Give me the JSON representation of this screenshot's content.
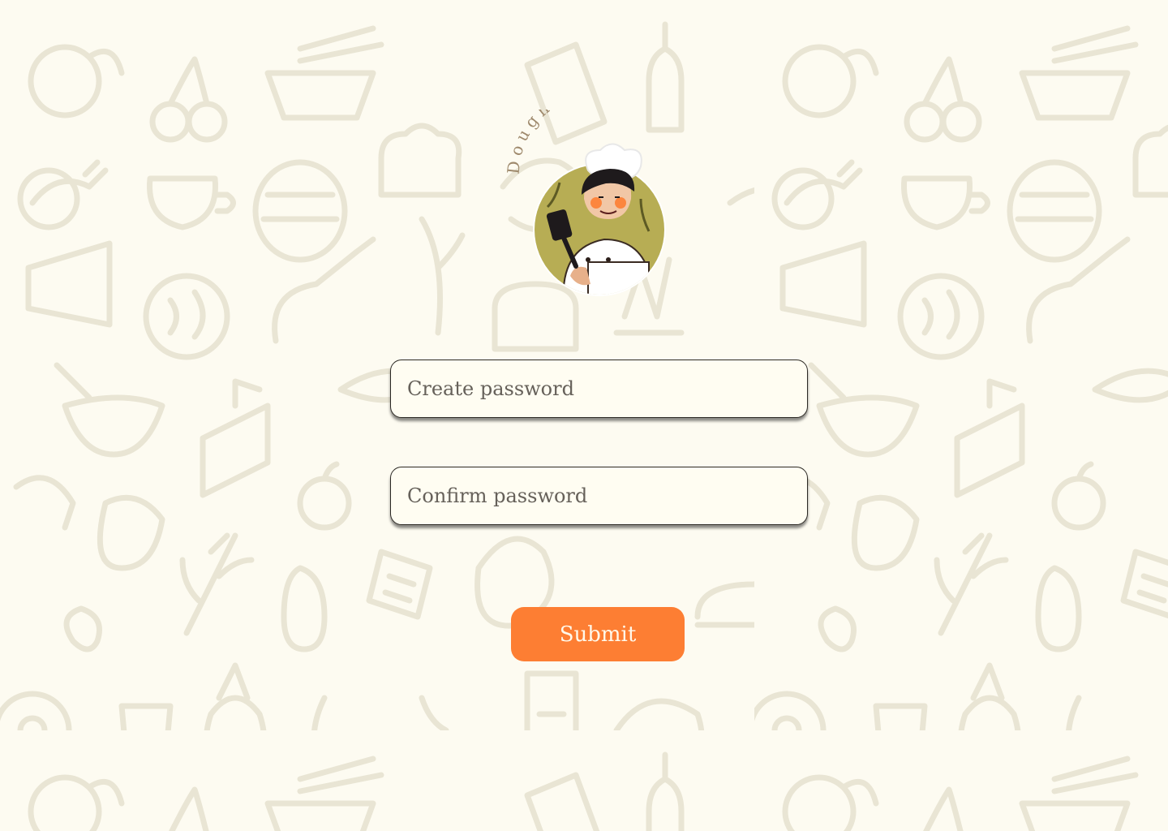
{
  "brand": {
    "name": "Dough-re-mi",
    "logo_icon": "chef-with-spatula-icon"
  },
  "form": {
    "create_password_placeholder": "Create password",
    "confirm_password_placeholder": "Confirm password",
    "submit_label": "Submit"
  },
  "colors": {
    "background": "#fdfbf1",
    "pattern": "#e9e5d4",
    "accent": "#fd7e33",
    "field_border": "#2d2a25",
    "logo_circle": "#b7ad54"
  },
  "background_pattern_icon": "food-doodle-pattern"
}
